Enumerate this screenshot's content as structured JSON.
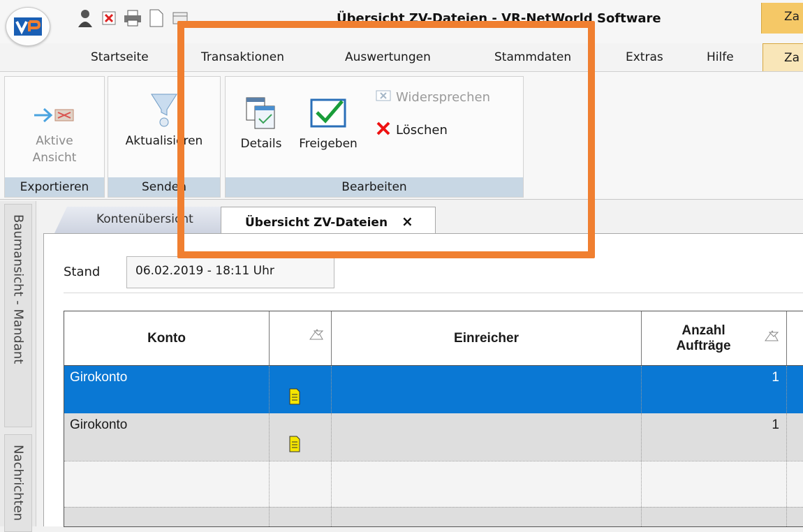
{
  "window": {
    "title": "Übersicht ZV-Dateien - VR-NetWorld Software",
    "side_tab_label": "Za"
  },
  "menu": {
    "items": [
      "Startseite",
      "Transaktionen",
      "Auswertungen",
      "Stammdaten",
      "Extras",
      "Hilfe"
    ],
    "active_contextual": "Za"
  },
  "ribbon": {
    "groups": {
      "exportieren": {
        "label": "Exportieren",
        "button": "Aktive Ansicht"
      },
      "senden": {
        "label": "Senden",
        "button": "Aktualisieren"
      },
      "bearbeiten": {
        "label": "Bearbeiten",
        "details": "Details",
        "freigeben": "Freigeben",
        "widersprechen": "Widersprechen",
        "loeschen": "Löschen"
      }
    }
  },
  "left_panel": {
    "tabs": [
      "Baumansicht - Mandant",
      "Nachrichten"
    ]
  },
  "doc_tabs": {
    "inactive": "Kontenübersicht",
    "active": "Übersicht ZV-Dateien",
    "close_glyph": "×"
  },
  "stand": {
    "label": "Stand",
    "value": "06.02.2019 - 18:11 Uhr"
  },
  "table": {
    "headers": {
      "konto": "Konto",
      "einreicher": "Einreicher",
      "anzahl": "Anzahl Aufträge"
    },
    "rows": [
      {
        "konto": "Girokonto",
        "einreicher": "",
        "anzahl": "1",
        "selected": true
      },
      {
        "konto": "Girokonto",
        "einreicher": "",
        "anzahl": "1",
        "selected": false
      }
    ]
  },
  "colors": {
    "highlight": "#f07f30",
    "selection": "#0a78d4",
    "group_label": "#c8d7e4",
    "context_tab": "#f5c866"
  },
  "icons": {
    "logo": "volksbank-logo-icon",
    "details": "details-document-icon",
    "freigeben": "checkmark-icon",
    "loeschen": "red-x-icon",
    "widersprechen": "widersprechen-icon",
    "row_document": "document-icon",
    "sort": "sort-filter-icon"
  }
}
